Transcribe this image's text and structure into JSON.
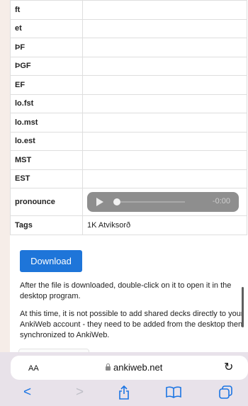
{
  "fields": [
    {
      "label": "ft",
      "value": ""
    },
    {
      "label": "et",
      "value": ""
    },
    {
      "label": "ÞF",
      "value": ""
    },
    {
      "label": "ÞGF",
      "value": ""
    },
    {
      "label": "EF",
      "value": ""
    },
    {
      "label": "lo.fst",
      "value": ""
    },
    {
      "label": "lo.mst",
      "value": ""
    },
    {
      "label": "lo.est",
      "value": ""
    },
    {
      "label": "MST",
      "value": ""
    },
    {
      "label": "EST",
      "value": ""
    }
  ],
  "pronounce": {
    "label": "pronounce",
    "time": "-0:00",
    "progress": 0
  },
  "tags": {
    "label": "Tags",
    "value": "1K Atviksorð"
  },
  "download_label": "Download",
  "para1": "After the file is downloaded, double-click on it to open it in the desktop program.",
  "para2": "At this time, it is not possible to add shared decks directly to your AnkiWeb account - they need to be added from the desktop then synchronized to AnkiWeb.",
  "browser": {
    "aa_label": "AA",
    "url": "ankiweb.net"
  }
}
